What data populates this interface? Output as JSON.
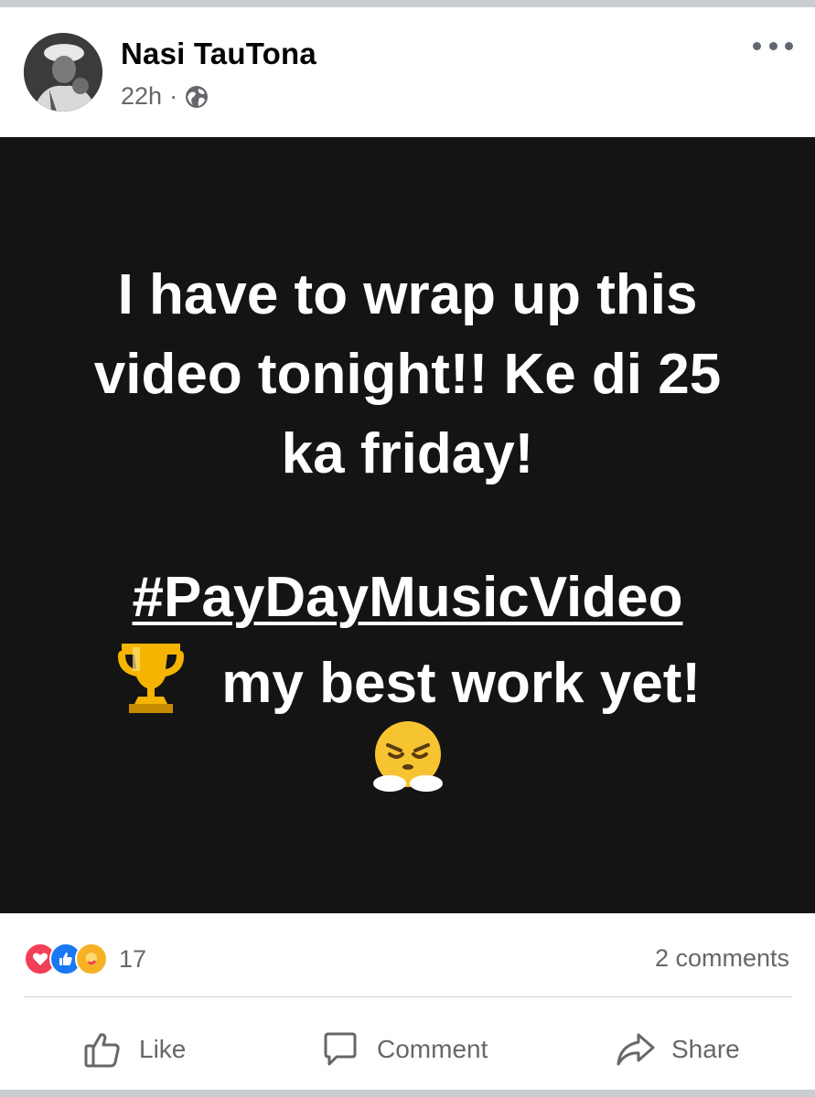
{
  "post": {
    "author": "Nasi TauTona",
    "time": "22h",
    "separator": "·",
    "privacy_icon": "globe-icon",
    "more_icon": "more-options-icon",
    "background_color": "#141414",
    "text_lines": [
      "I have to wrap up this",
      "video tonight!! Ke di 25",
      "ka friday!"
    ],
    "hashtag": "#PayDayMusicVideo",
    "line_after_hashtag": "my best work yet!",
    "emojis": [
      "trophy-emoji",
      "face-with-steam-emoji"
    ]
  },
  "stats": {
    "reaction_icons": [
      "love-reaction-icon",
      "like-reaction-icon",
      "care-reaction-icon"
    ],
    "reaction_count": "17",
    "comments": "2 comments"
  },
  "actions": {
    "like": "Like",
    "comment": "Comment",
    "share": "Share"
  },
  "colors": {
    "text_secondary": "#65676b",
    "author_text": "#050505",
    "like_blue": "#1877f2",
    "love_red": "#f33e58",
    "care_yellow": "#f7b125"
  }
}
